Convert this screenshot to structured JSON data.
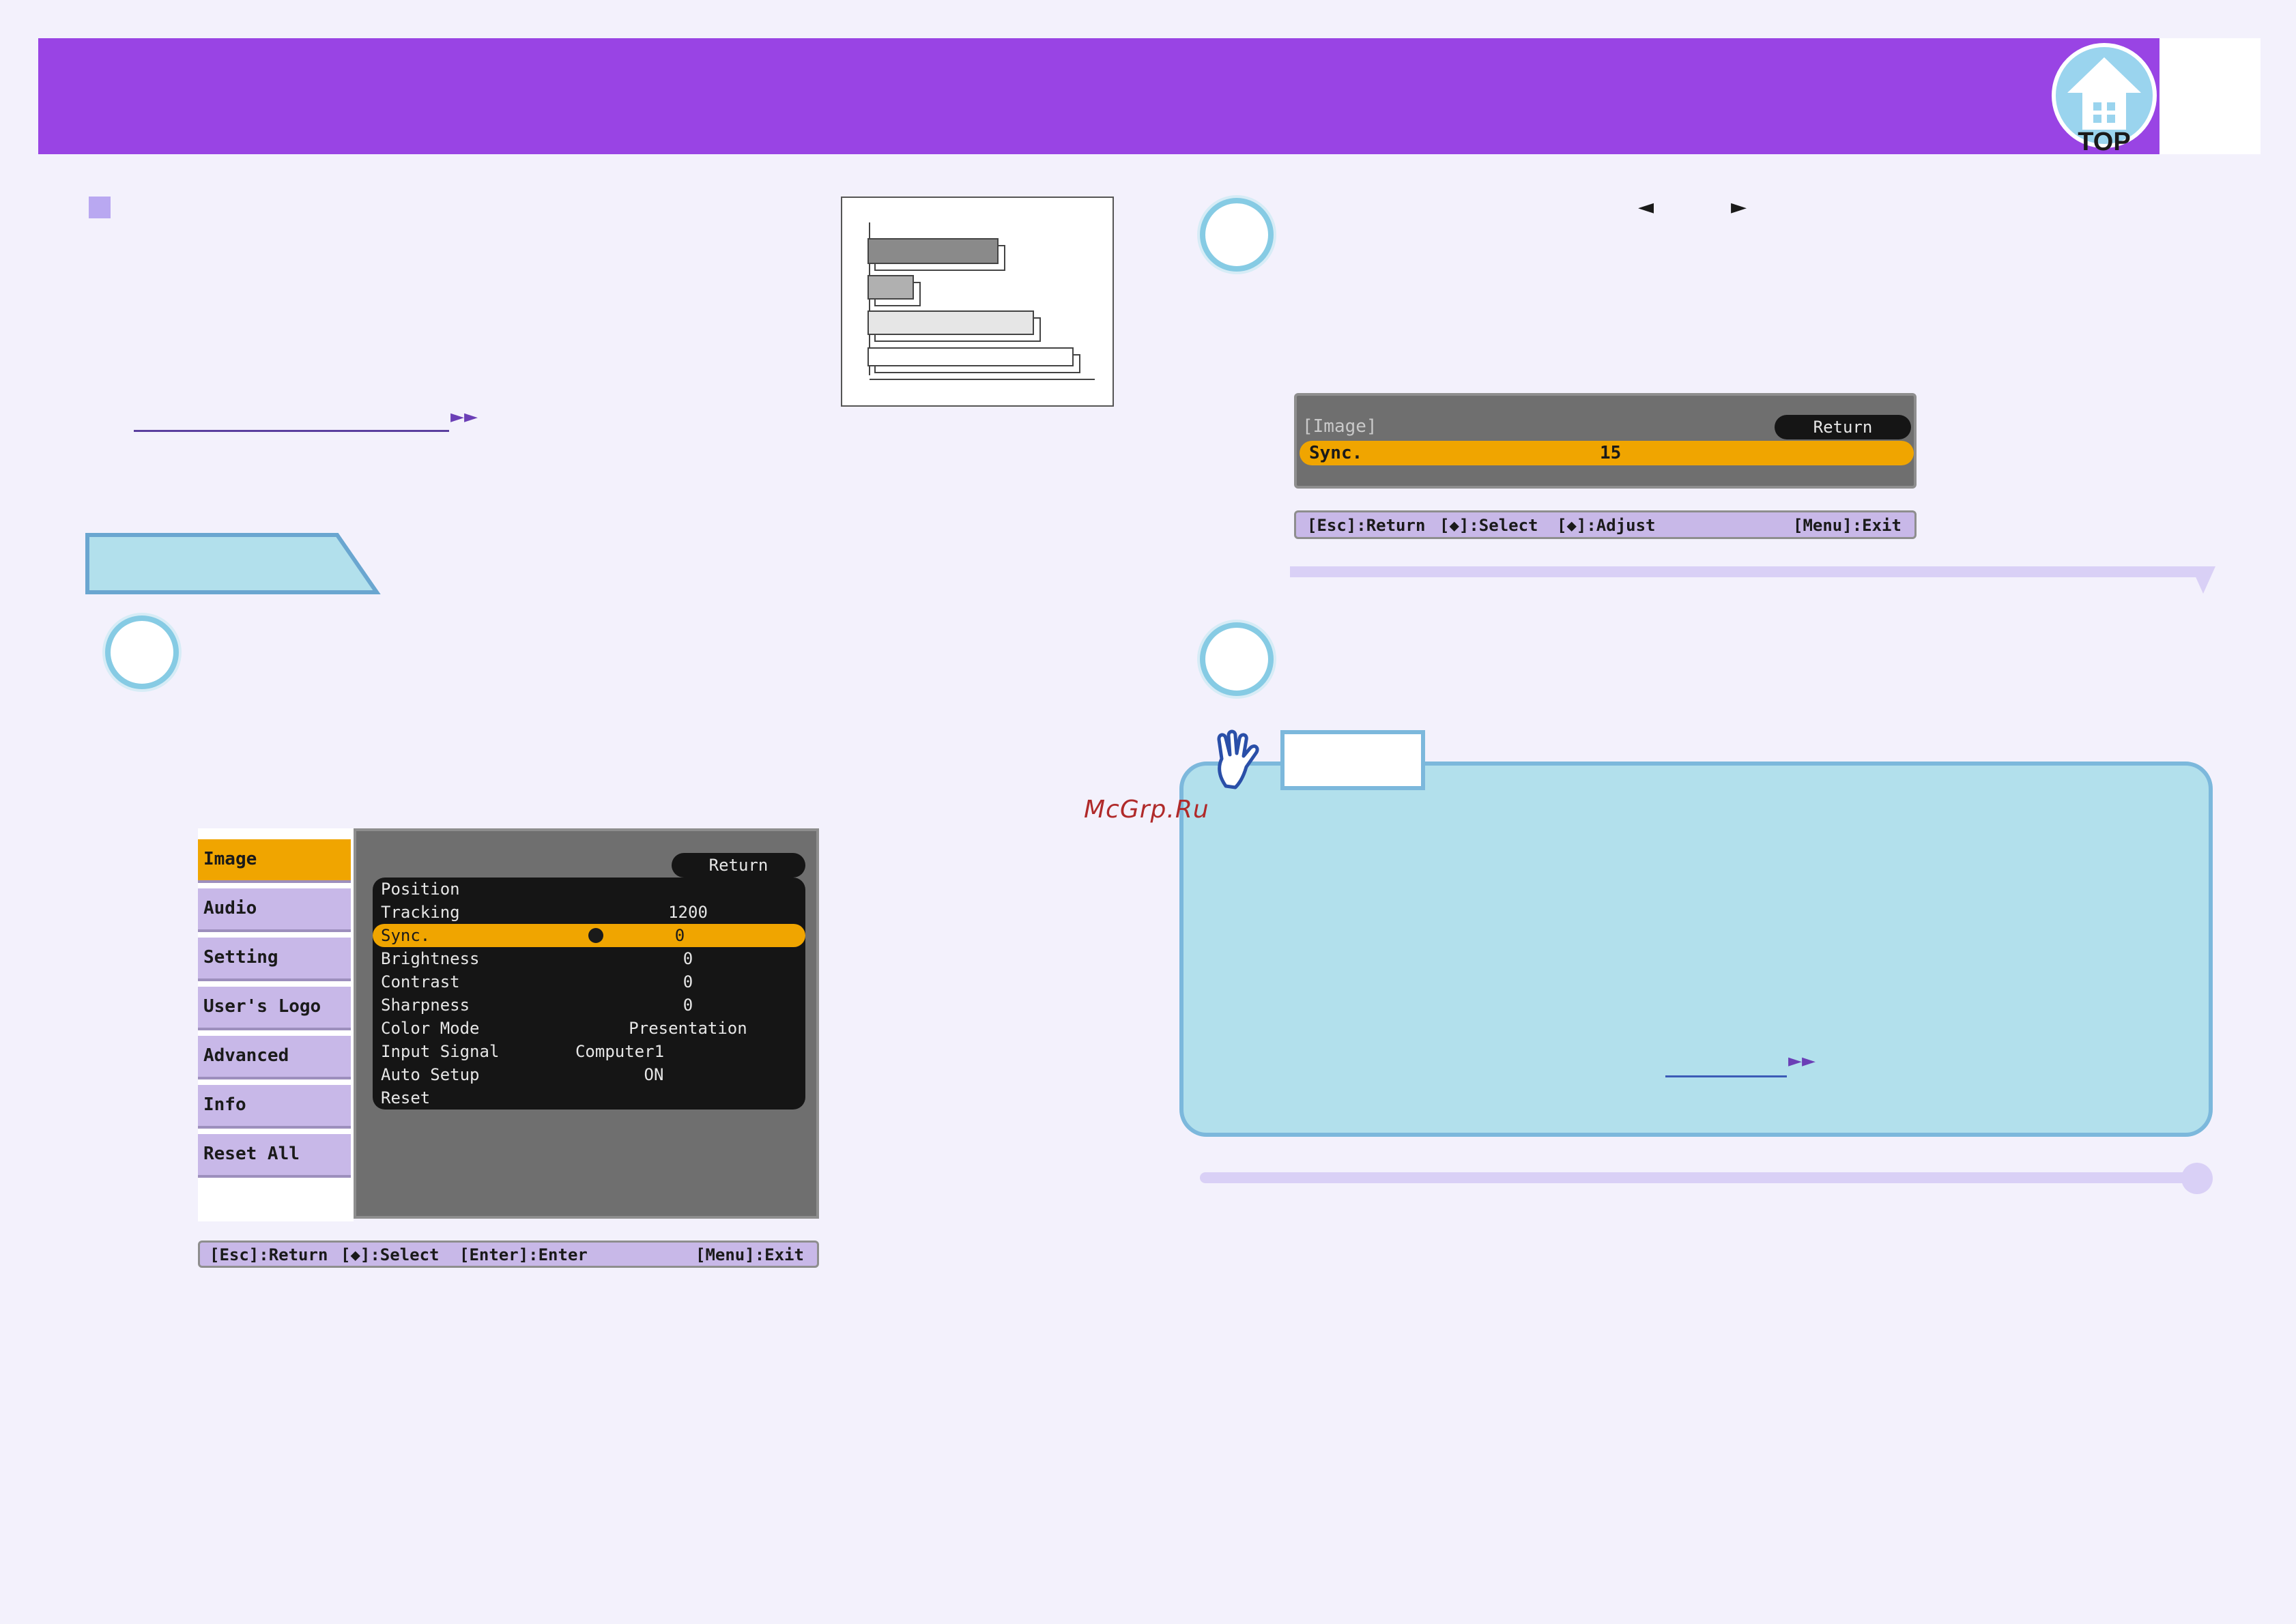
{
  "header": {
    "logo_text": "TOP"
  },
  "nav": {
    "left_arrow": "◄",
    "right_arrow": "►"
  },
  "watermark": "McGrp.Ru",
  "osd_menu": {
    "left_items": [
      "Image",
      "Audio",
      "Setting",
      "User's Logo",
      "Advanced",
      "Info",
      "Reset All"
    ],
    "active_item": "Image",
    "return_label": "Return",
    "rows": [
      {
        "label": "Position",
        "value": ""
      },
      {
        "label": "Tracking",
        "value": "1200"
      },
      {
        "label": "Sync.",
        "value": "0",
        "selected": true
      },
      {
        "label": "Brightness",
        "value": "0"
      },
      {
        "label": "Contrast",
        "value": "0"
      },
      {
        "label": "Sharpness",
        "value": "0"
      },
      {
        "label": "Color Mode",
        "value": "Presentation"
      },
      {
        "label": "Input Signal",
        "value": "Computer1"
      },
      {
        "label": "Auto Setup",
        "value": "ON"
      },
      {
        "label": "Reset",
        "value": ""
      }
    ],
    "footer": {
      "esc": "[Esc]:Return",
      "select": "[◆]:Select",
      "enter": "[Enter]:Enter",
      "menu": "[Menu]:Exit"
    }
  },
  "osd_sync": {
    "title": "[Image]",
    "return_label": "Return",
    "row_label": "Sync.",
    "row_value": "15",
    "footer": {
      "esc": "[Esc]:Return",
      "select": "[◆]:Select",
      "adjust": "[◆]:Adjust",
      "menu": "[Menu]:Exit"
    }
  },
  "colors": {
    "header": "#9944e4",
    "osd_highlight": "#f0a500",
    "osd_menu_item": "#c8b8e8",
    "tip_box": "#b2e0ec",
    "accent_border": "#7cb8dc"
  }
}
